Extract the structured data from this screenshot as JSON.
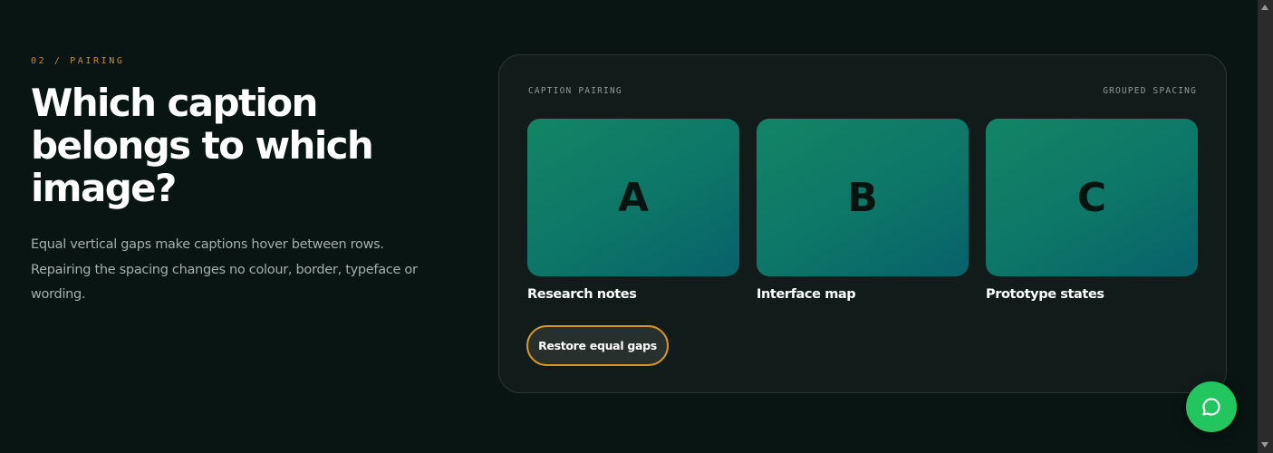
{
  "section": {
    "eyebrow": "02 / PAIRING",
    "headline": "Which caption belongs to which image?",
    "lede": "Equal vertical gaps make captions hover between rows. Repairing the spacing changes no colour, border, typeface or wording."
  },
  "card": {
    "left_label": "CAPTION PAIRING",
    "right_label": "GROUPED SPACING",
    "tiles": [
      {
        "letter": "A",
        "caption": "Research notes"
      },
      {
        "letter": "B",
        "caption": "Interface map"
      },
      {
        "letter": "C",
        "caption": "Prototype states"
      }
    ],
    "button_label": "Restore equal gaps"
  },
  "colors": {
    "background": "#081512",
    "accent": "#d6962c",
    "tile_gradient_start": "#138565",
    "tile_gradient_end": "#07616a",
    "chat_button": "#22c55e"
  },
  "icons": {
    "chat": "chat-bubble-icon"
  }
}
